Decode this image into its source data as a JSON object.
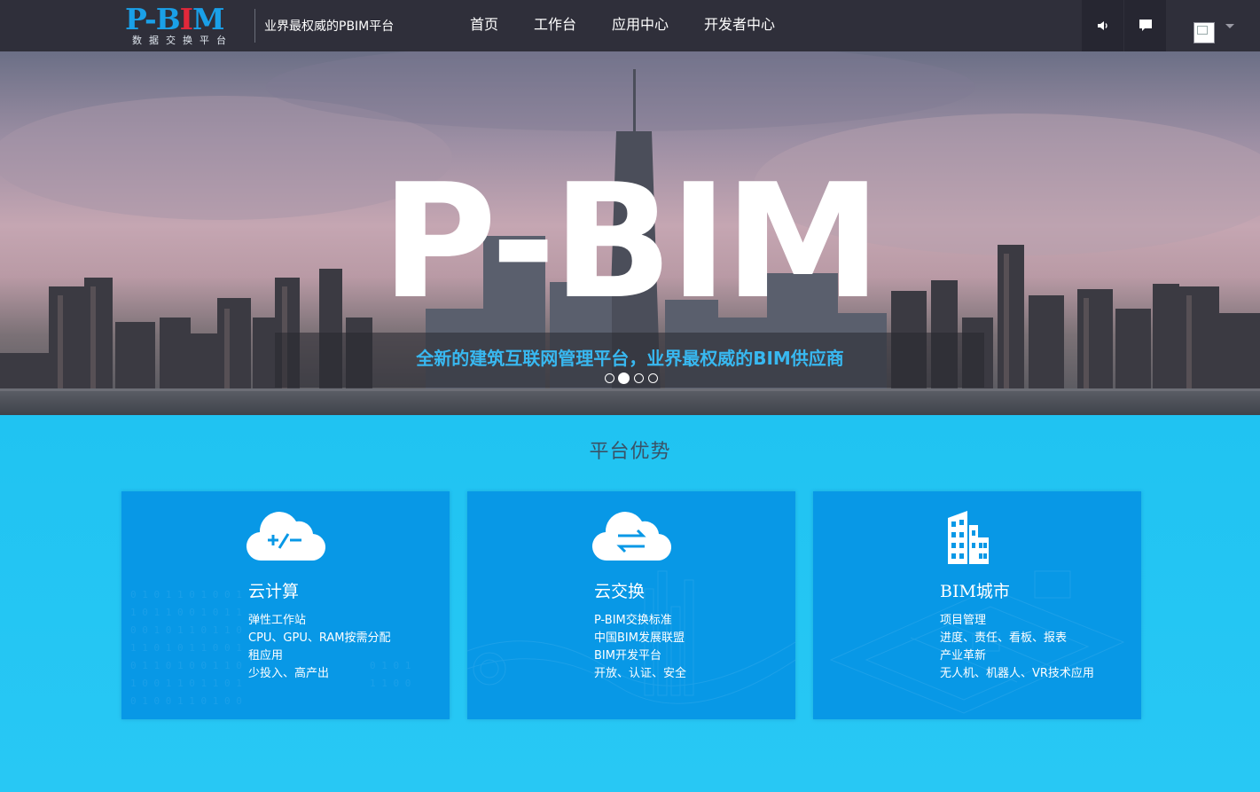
{
  "header": {
    "logo_text_1": "P-B",
    "logo_text_2": "I",
    "logo_text_3": "M",
    "logo_subtitle": "数据交换平台",
    "slogan": "业界最权威的PBIM平台",
    "nav": [
      {
        "label": "首页"
      },
      {
        "label": "工作台"
      },
      {
        "label": "应用中心"
      },
      {
        "label": "开发者中心"
      }
    ]
  },
  "hero": {
    "title": "P-BIM",
    "tagline": "全新的建筑互联网管理平台，业界最权威的BIM供应商",
    "slide_count": 4,
    "active_slide": 2
  },
  "advantages": {
    "title": "平台优势",
    "cards": [
      {
        "icon": "cloud-plus-minus-icon",
        "title": "云计算",
        "lines": [
          "弹性工作站",
          "CPU、GPU、RAM按需分配",
          "租应用",
          "少投入、高产出"
        ]
      },
      {
        "icon": "cloud-exchange-icon",
        "title": "云交换",
        "lines": [
          "P-BIM交换标准",
          "中国BIM发展联盟",
          "BIM开发平台",
          "开放、认证、安全"
        ]
      },
      {
        "icon": "building-icon",
        "title": "BIM城市",
        "lines": [
          "项目管理",
          "进度、责任、看板、报表",
          "产业革新",
          "无人机、机器人、VR技术应用"
        ]
      }
    ]
  },
  "colors": {
    "topbar": "#2f2f3a",
    "accent_blue": "#1aa0e8",
    "logo_red": "#e2283a",
    "section_bg": "#25c6f2",
    "card_bg": "#0898e6",
    "tagline": "#38b8f0"
  }
}
